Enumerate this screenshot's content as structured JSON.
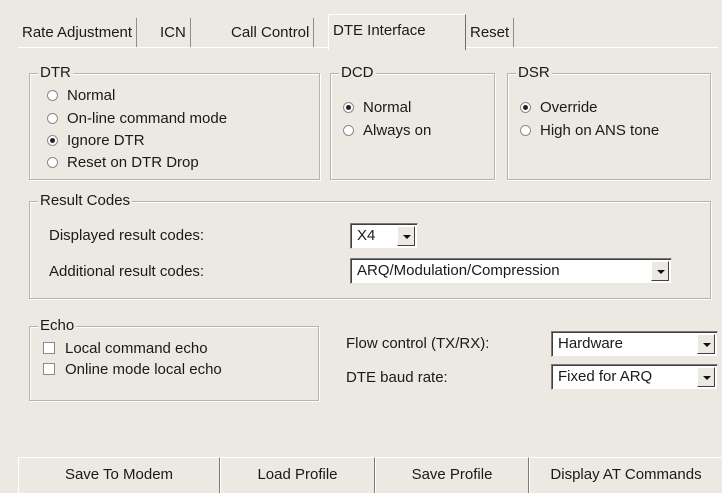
{
  "tabs": [
    {
      "label": "Rate Adjustment"
    },
    {
      "label": "ICN"
    },
    {
      "label": "Call Control"
    },
    {
      "label": "DTE Interface"
    },
    {
      "label": "Reset"
    }
  ],
  "dtr": {
    "legend": "DTR",
    "options": [
      {
        "label": "Normal",
        "selected": false
      },
      {
        "label": "On-line command mode",
        "selected": false
      },
      {
        "label": "Ignore DTR",
        "selected": true
      },
      {
        "label": "Reset on DTR Drop",
        "selected": false
      }
    ]
  },
  "dcd": {
    "legend": "DCD",
    "options": [
      {
        "label": "Normal",
        "selected": true
      },
      {
        "label": "Always on",
        "selected": false
      }
    ]
  },
  "dsr": {
    "legend": "DSR",
    "options": [
      {
        "label": "Override",
        "selected": true
      },
      {
        "label": "High on ANS tone",
        "selected": false
      }
    ]
  },
  "result_codes": {
    "legend": "Result Codes",
    "displayed_label": "Displayed result codes:",
    "displayed_value": "X4",
    "additional_label": "Additional result codes:",
    "additional_value": "ARQ/Modulation/Compression"
  },
  "echo": {
    "legend": "Echo",
    "options": [
      {
        "label": "Local command echo",
        "checked": false
      },
      {
        "label": "Online mode local echo",
        "checked": false
      }
    ]
  },
  "flow_control": {
    "label": "Flow control (TX/RX):",
    "value": "Hardware"
  },
  "baud_rate": {
    "label": "DTE baud rate:",
    "value": "Fixed for ARQ"
  },
  "buttons": {
    "save_to_modem": "Save To Modem",
    "load_profile": "Load Profile",
    "save_profile": "Save Profile",
    "display_at": "Display AT Commands"
  }
}
